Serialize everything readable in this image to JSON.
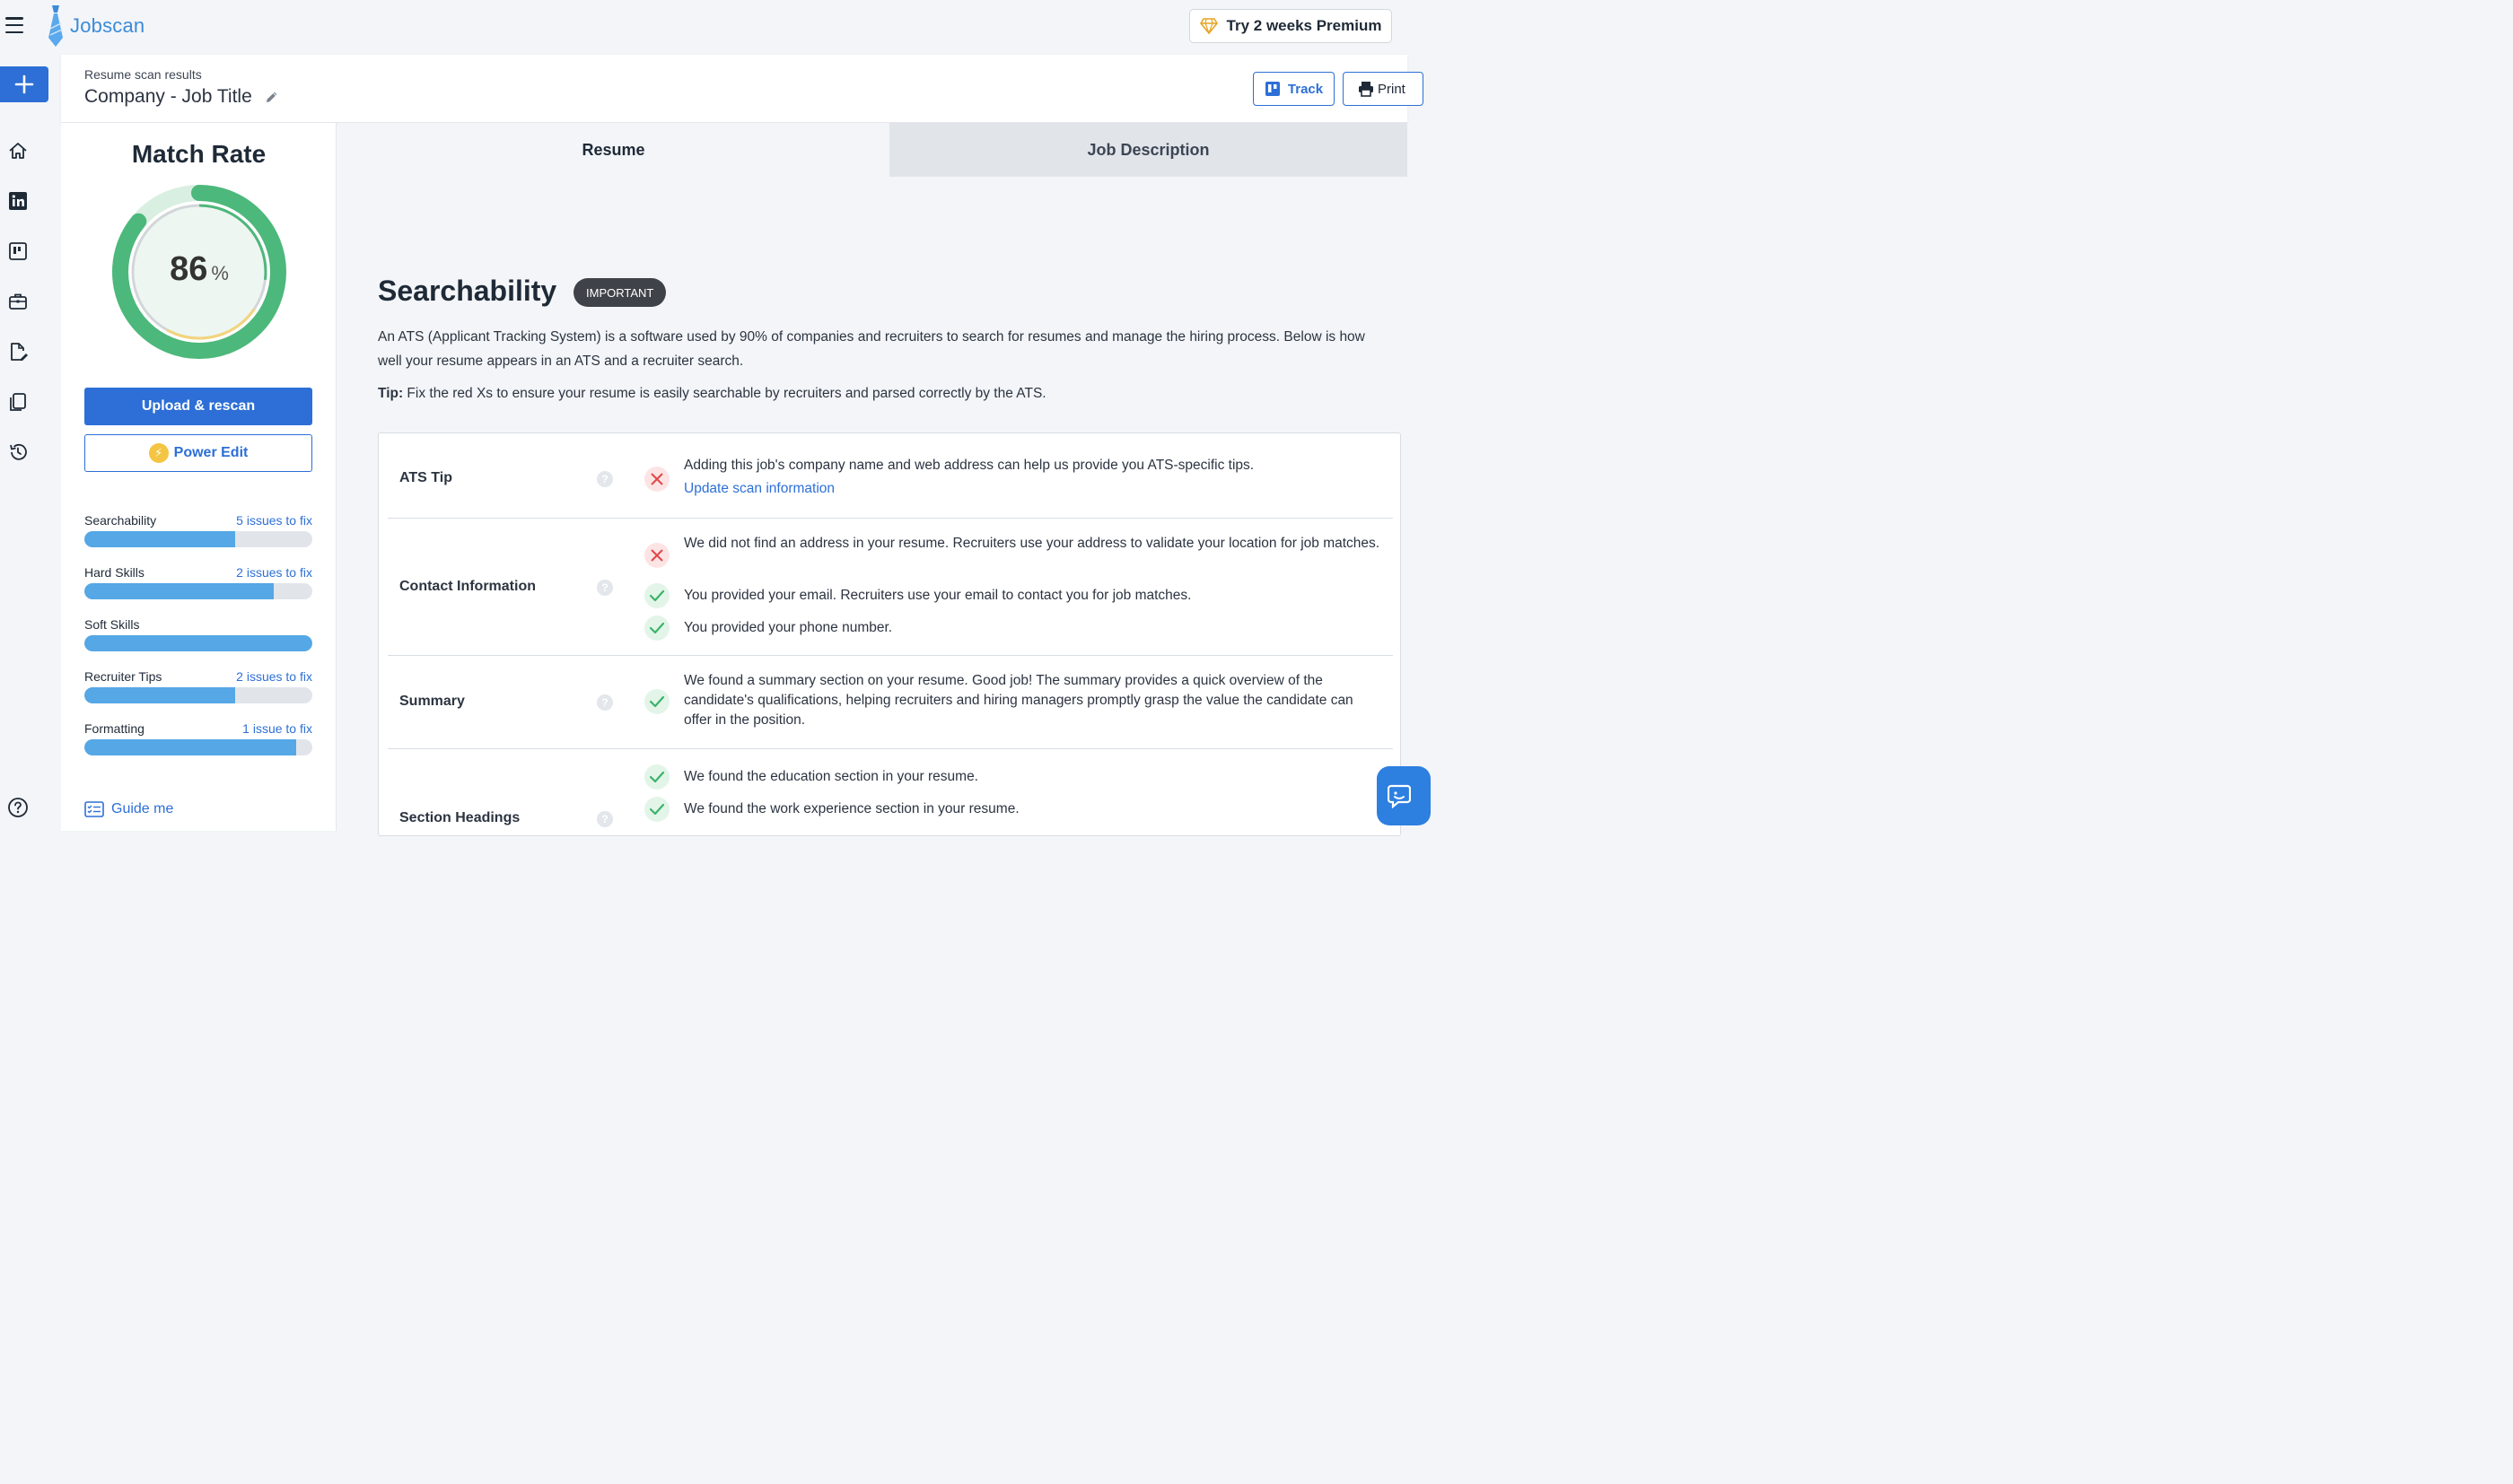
{
  "app": {
    "name": "Jobscan"
  },
  "topbar": {
    "premium_label": "Try 2 weeks Premium"
  },
  "header": {
    "subtitle": "Resume scan results",
    "title": "Company - Job Title",
    "track_label": "Track",
    "print_label": "Print"
  },
  "sidebar": {
    "match_title": "Match Rate",
    "match_value": "86",
    "match_unit": "%",
    "upload_label": "Upload & rescan",
    "power_edit_label": "Power Edit",
    "categories": [
      {
        "name": "Searchability",
        "issues": "5 issues to fix",
        "progress": 0.66
      },
      {
        "name": "Hard Skills",
        "issues": "2 issues to fix",
        "progress": 0.83
      },
      {
        "name": "Soft Skills",
        "issues": "",
        "progress": 1.0
      },
      {
        "name": "Recruiter Tips",
        "issues": "2 issues to fix",
        "progress": 0.66
      },
      {
        "name": "Formatting",
        "issues": "1 issue to fix",
        "progress": 0.93
      }
    ],
    "guide_label": "Guide me"
  },
  "tabs": [
    {
      "label": "Resume",
      "active": true
    },
    {
      "label": "Job Description",
      "active": false
    }
  ],
  "main": {
    "section_title": "Searchability",
    "badge": "IMPORTANT",
    "description": "An ATS (Applicant Tracking System) is a software used by 90% of companies and recruiters to search for resumes and manage the hiring process. Below is how well your resume appears in an ATS and a recruiter search.",
    "tip_label": "Tip:",
    "tip_text": " Fix the red Xs to ensure your resume is easily searchable by recruiters and parsed correctly by the ATS.",
    "rows": [
      {
        "label": "ATS Tip",
        "checks": [
          {
            "status": "fail",
            "text": "Adding this job's company name and web address can help us provide you ATS-specific tips.",
            "link": "Update scan information"
          }
        ]
      },
      {
        "label": "Contact Information",
        "checks": [
          {
            "status": "fail",
            "text": "We did not find an address in your resume. Recruiters use your address to validate your location for job matches."
          },
          {
            "status": "pass",
            "text": "You provided your email. Recruiters use your email to contact you for job matches."
          },
          {
            "status": "pass",
            "text": "You provided your phone number."
          }
        ]
      },
      {
        "label": "Summary",
        "checks": [
          {
            "status": "pass",
            "text": "We found a summary section on your resume. Good job! The summary provides a quick overview of the candidate's qualifications, helping recruiters and hiring managers promptly grasp the value the candidate can offer in the position."
          }
        ]
      },
      {
        "label": "Section Headings",
        "checks": [
          {
            "status": "pass",
            "text": "We found the education section in your resume."
          },
          {
            "status": "pass",
            "text": "We found the work experience section in your resume."
          }
        ]
      }
    ],
    "help_glyph": "?"
  },
  "colors": {
    "accent": "#2d6fd6",
    "gauge_green": "#4cb87b",
    "gauge_yellow": "#f2d47a",
    "bar_blue": "#55a7e6"
  }
}
